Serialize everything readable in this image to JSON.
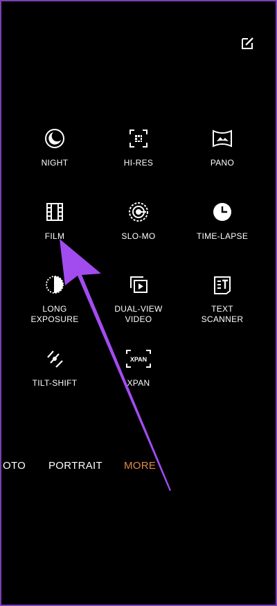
{
  "modes": [
    {
      "id": "night",
      "label": "NIGHT",
      "icon": "night-icon"
    },
    {
      "id": "hires",
      "label": "HI-RES",
      "icon": "hi-res-icon"
    },
    {
      "id": "pano",
      "label": "PANO",
      "icon": "pano-icon"
    },
    {
      "id": "film",
      "label": "FILM",
      "icon": "film-icon"
    },
    {
      "id": "slomo",
      "label": "SLO-MO",
      "icon": "slo-mo-icon"
    },
    {
      "id": "timelapse",
      "label": "TIME-LAPSE",
      "icon": "time-lapse-icon"
    },
    {
      "id": "longexposure",
      "label": "LONG\nEXPOSURE",
      "icon": "long-exposure-icon"
    },
    {
      "id": "dualview",
      "label": "DUAL-VIEW\nVIDEO",
      "icon": "dual-view-video-icon"
    },
    {
      "id": "textscanner",
      "label": "TEXT\nSCANNER",
      "icon": "text-scanner-icon"
    },
    {
      "id": "tiltshift",
      "label": "TILT-SHIFT",
      "icon": "tilt-shift-icon"
    },
    {
      "id": "xpan",
      "label": "XPAN",
      "icon": "xpan-icon",
      "icon_text": "XPAN"
    }
  ],
  "bottom_nav": {
    "photo": "OTO",
    "portrait": "PORTRAIT",
    "more": "MORE"
  },
  "colors": {
    "accent": "#e08a45",
    "arrow": "#a24cf0",
    "frame": "#7a3fb5"
  },
  "edit_icon": "edit-icon"
}
